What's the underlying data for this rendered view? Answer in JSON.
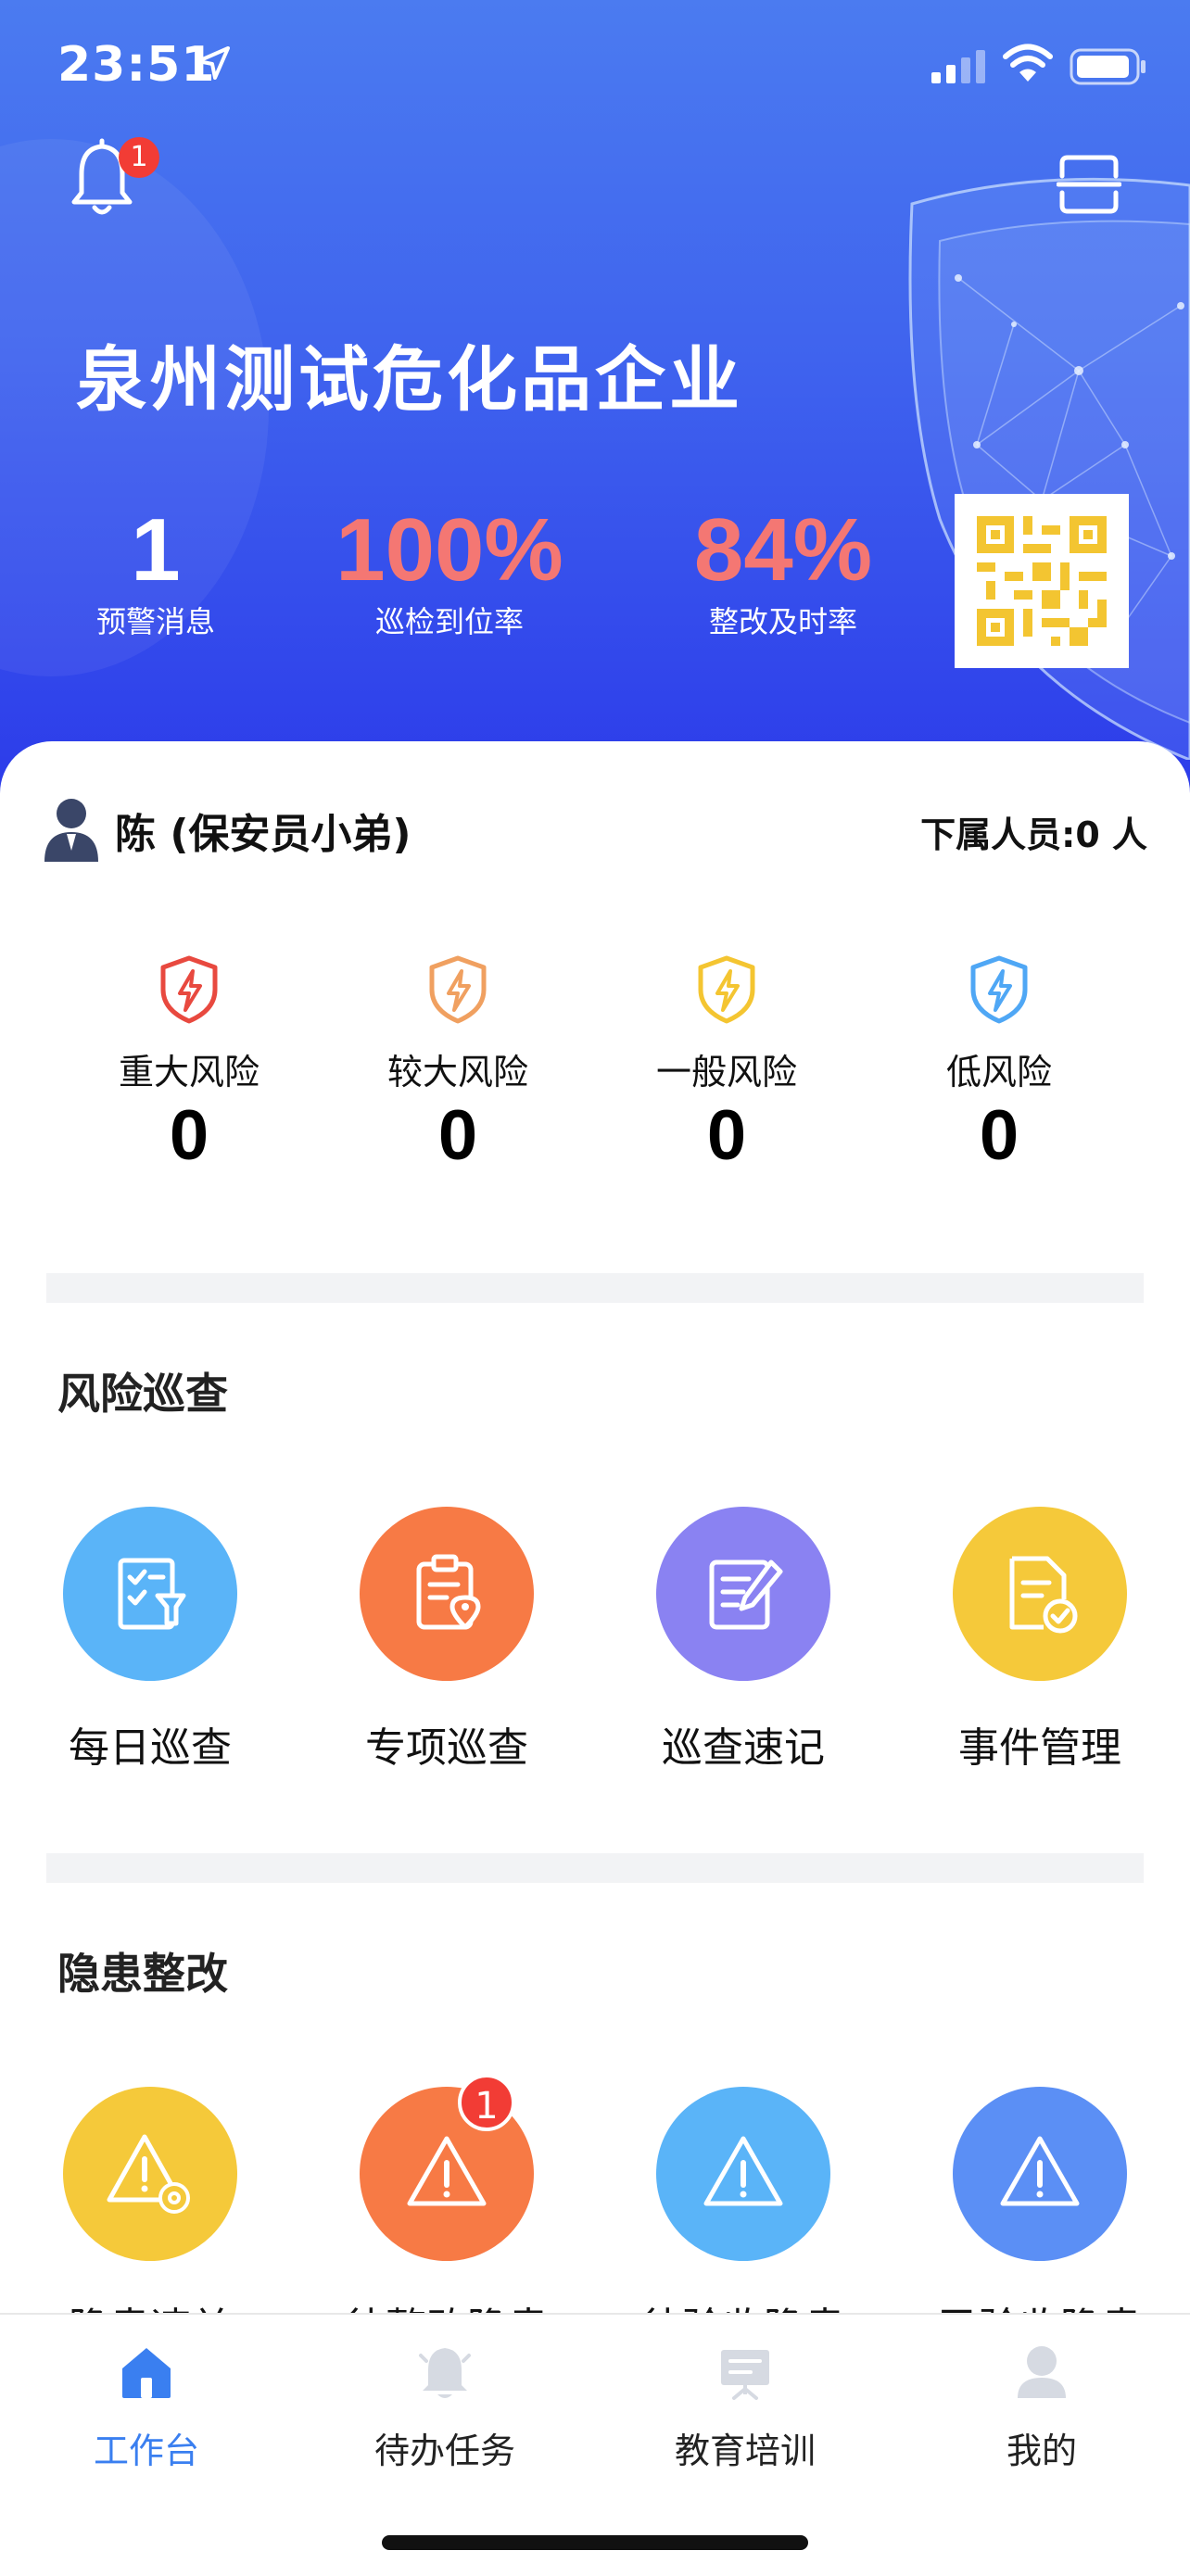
{
  "status_bar": {
    "time": "23:51"
  },
  "header": {
    "notification_badge": "1",
    "company_name": "泉州测试危化品企业",
    "stats": [
      {
        "value": "1",
        "label": "预警消息"
      },
      {
        "value": "100%",
        "label": "巡检到位率"
      },
      {
        "value": "84%",
        "label": "整改及时率"
      }
    ]
  },
  "user": {
    "name": "陈 (保安员小弟)",
    "subordinates": "下属人员:0 人"
  },
  "risk_levels": [
    {
      "label": "重大风险",
      "value": "0",
      "color": "#e8493f"
    },
    {
      "label": "较大风险",
      "value": "0",
      "color": "#f0a060"
    },
    {
      "label": "一般风险",
      "value": "0",
      "color": "#f4c531"
    },
    {
      "label": "低风险",
      "value": "0",
      "color": "#4fa7f5"
    }
  ],
  "sections": {
    "patrol": {
      "title": "风险巡查",
      "items": [
        {
          "label": "每日巡查",
          "color": "#5ab4f8",
          "icon": "checklist-icon"
        },
        {
          "label": "专项巡查",
          "color": "#f77a45",
          "icon": "clipboard-location-icon"
        },
        {
          "label": "巡查速记",
          "color": "#8a82f2",
          "icon": "note-edit-icon"
        },
        {
          "label": "事件管理",
          "color": "#f5c93a",
          "icon": "document-check-icon"
        }
      ]
    },
    "hazard": {
      "title": "隐患整改",
      "items": [
        {
          "label": "隐患速关",
          "color": "#f5c93a",
          "icon": "warning-gear-icon",
          "badge": ""
        },
        {
          "label": "待整改隐患",
          "color": "#f77a45",
          "icon": "warning-icon",
          "badge": "1"
        },
        {
          "label": "待验收隐患",
          "color": "#5ab4f8",
          "icon": "warning-icon",
          "badge": ""
        },
        {
          "label": "已验收隐患",
          "color": "#5b8ff5",
          "icon": "warning-icon",
          "badge": ""
        }
      ]
    }
  },
  "tabbar": {
    "items": [
      {
        "label": "工作台",
        "icon": "home-icon",
        "active": true
      },
      {
        "label": "待办任务",
        "icon": "bell-icon",
        "active": false
      },
      {
        "label": "教育培训",
        "icon": "presentation-icon",
        "active": false
      },
      {
        "label": "我的",
        "icon": "user-icon",
        "active": false
      }
    ]
  },
  "colors": {
    "header_gradient_top": "#4b7bf0",
    "header_gradient_bottom": "#2c3bea",
    "stat_highlight": "#f47773",
    "active_tab": "#3a7ff0",
    "badge": "#f23c35"
  }
}
